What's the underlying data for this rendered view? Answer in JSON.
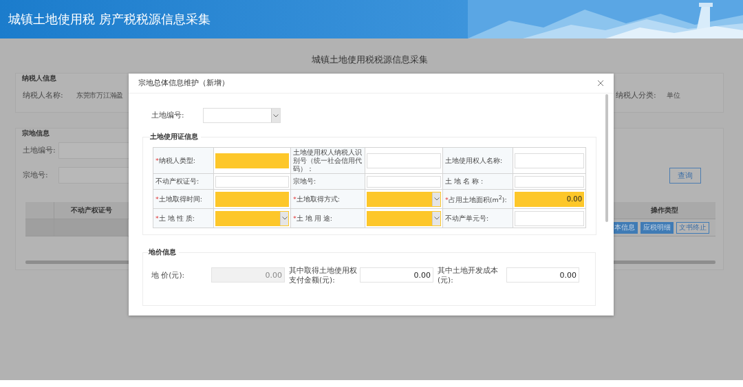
{
  "header": {
    "title": "城镇土地使用税 房产税税源信息采集"
  },
  "page": {
    "title": "城镇土地使用税税源信息采集",
    "taxpayer_section": {
      "legend": "纳税人信息",
      "fields": [
        {
          "label": "纳税人名称:",
          "value": "东莞市万江瀚盈"
        },
        {
          "label": "纳税人分类:",
          "value": "单位"
        }
      ]
    },
    "parcel_section": {
      "legend": "宗地信息",
      "fields": [
        {
          "label": "土地编号:"
        },
        {
          "label": "宗地号:"
        }
      ],
      "query_button": "查询",
      "table": {
        "columns": [
          {
            "label": "不动产权证号"
          },
          {
            "label": "操作类型"
          }
        ],
        "rows": [
          {
            "actions": [
              {
                "label": "本信息",
                "kind": "filled"
              },
              {
                "label": "应税明细",
                "kind": "filled"
              },
              {
                "label": "文书终止",
                "kind": "outline"
              }
            ]
          }
        ]
      }
    }
  },
  "dialog": {
    "title": "宗地总体信息维护（新增）",
    "land_number": {
      "label": "土地编号:",
      "kind": "select"
    },
    "certificate_section": {
      "legend": "土地使用证信息",
      "rows": [
        [
          {
            "mark": "*",
            "label": "纳税人类型:",
            "kind": "input",
            "highlighted": true
          },
          {
            "label": "土地使用权人纳税人识别号（统一社会信用代码）：",
            "kind": "input",
            "highlighted": false
          },
          {
            "label": "土地使用权人名称:",
            "kind": "input",
            "highlighted": false
          }
        ],
        [
          {
            "label": "不动产权证号:",
            "kind": "input",
            "highlighted": false
          },
          {
            "label": "宗地号:",
            "kind": "input",
            "highlighted": false
          },
          {
            "label": "土 地 名 称 :",
            "kind": "input",
            "highlighted": false
          }
        ],
        [
          {
            "mark": "*",
            "label": "土地取得时间:",
            "kind": "input",
            "highlighted": true
          },
          {
            "mark": "*",
            "label": "土地取得方式:",
            "kind": "select",
            "highlighted": true
          },
          {
            "mark": "*",
            "label": "占用土地面积(m$^{2}$):",
            "kind": "input",
            "highlighted": true,
            "value": "0.00"
          }
        ],
        [
          {
            "mark": "*",
            "label": "土 地 性 质:",
            "kind": "select",
            "highlighted": true
          },
          {
            "mark": "*",
            "label": "土 地 用 途:",
            "kind": "select",
            "highlighted": true
          },
          {
            "label": "不动产单元号:",
            "kind": "input",
            "highlighted": false
          }
        ]
      ]
    },
    "price_section": {
      "legend": "地价信息",
      "fields": [
        {
          "label": "地 价(元):",
          "value": "0.00",
          "disabled": true
        },
        {
          "label": "其中取得土地使用权支付金额(元):",
          "value": "0.00",
          "disabled": false
        },
        {
          "label": "其中土地开发成本(元):",
          "value": "0.00",
          "disabled": false
        }
      ]
    }
  }
}
